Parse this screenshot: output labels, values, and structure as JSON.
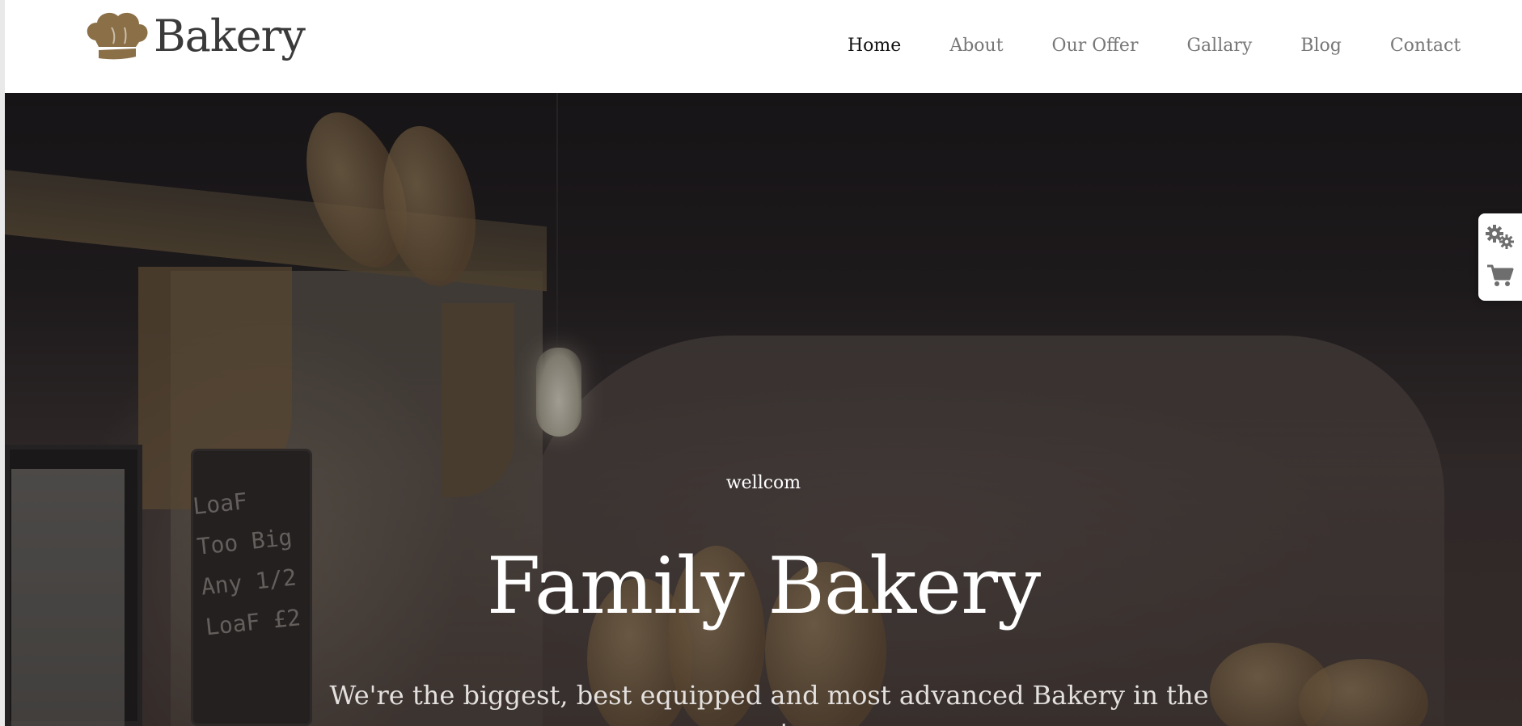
{
  "header": {
    "logo_text": "Bakery",
    "logo_icon": "chef-hat-icon",
    "nav": [
      {
        "label": "Home",
        "active": true
      },
      {
        "label": "About",
        "active": false
      },
      {
        "label": "Our Offer",
        "active": false
      },
      {
        "label": "Gallary",
        "active": false
      },
      {
        "label": "Blog",
        "active": false
      },
      {
        "label": "Contact",
        "active": false
      }
    ]
  },
  "hero": {
    "welcome": "wellcom",
    "title": "Family Bakery",
    "subtitle": "We're the biggest, best equipped and most advanced Bakery in the greater",
    "chalkboard_text": "LoaF Too Big Any 1/2 LoaF £2"
  },
  "side_widget": {
    "buttons": [
      {
        "icon": "gears-icon"
      },
      {
        "icon": "shopping-cart-icon"
      }
    ]
  },
  "colors": {
    "logo_brown": "#8b6f47",
    "logo_text": "#3a3a3a",
    "nav_active": "#111111",
    "nav_inactive": "#777777",
    "hero_text": "#ffffff"
  }
}
